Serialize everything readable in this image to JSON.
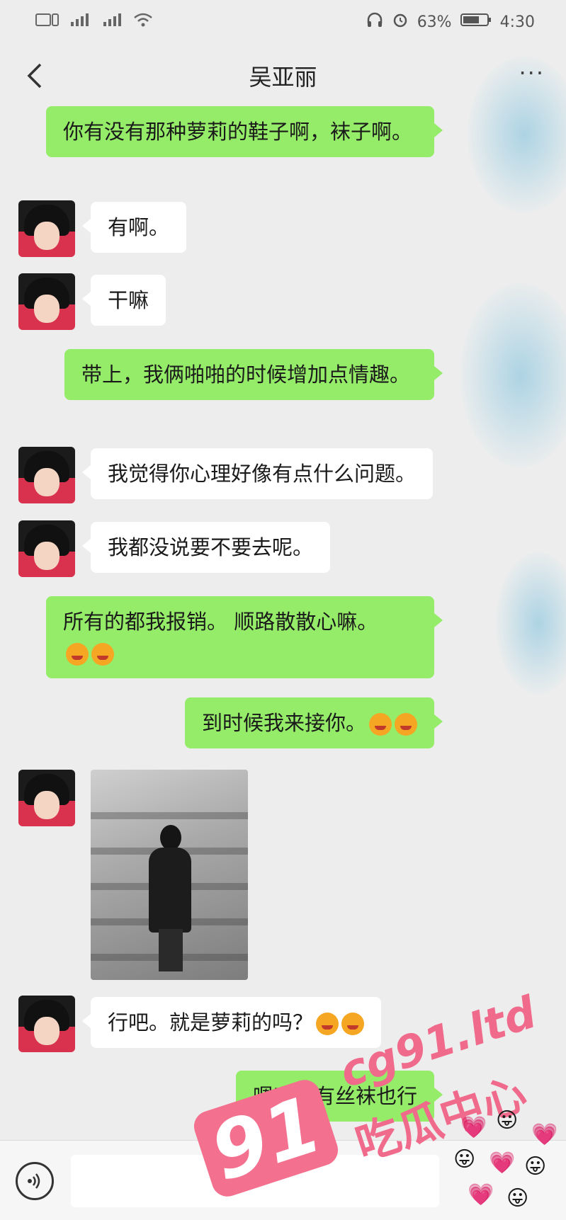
{
  "status_bar": {
    "left_icons": [
      "sim-card-icon",
      "signal-1-icon",
      "signal-2-icon",
      "wifi-icon"
    ],
    "battery": "63%",
    "time": "4:30"
  },
  "header": {
    "title": "吴亚丽",
    "more": "···"
  },
  "messages": [
    {
      "side": "out",
      "text": "你有没有那种萝莉的鞋子啊，袜子啊。"
    },
    {
      "side": "in",
      "text": "有啊。"
    },
    {
      "side": "in",
      "text": "干嘛"
    },
    {
      "side": "out",
      "text": "带上，我俩啪啪的时候增加点情趣。"
    },
    {
      "side": "in",
      "text": "我觉得你心理好像有点什么问题。"
    },
    {
      "side": "in",
      "text": "我都没说要不要去呢。"
    },
    {
      "side": "out",
      "text": "所有的都我报销。 顺路散散心嘛。"
    },
    {
      "side": "out",
      "text": "到时候我来接你。"
    },
    {
      "side": "in",
      "type": "image",
      "text": ""
    },
    {
      "side": "in",
      "text": "行吧。就是萝莉的吗？"
    },
    {
      "side": "out",
      "text": "嗯嗯，有丝袜也行"
    }
  ],
  "watermark": {
    "number": "91",
    "url": "cg91.ltd",
    "name": "吃瓜中心"
  },
  "colors": {
    "outgoing_bubble": "#95ec69",
    "incoming_bubble": "#ffffff",
    "background": "#ededed",
    "watermark": "#f06a8c"
  }
}
